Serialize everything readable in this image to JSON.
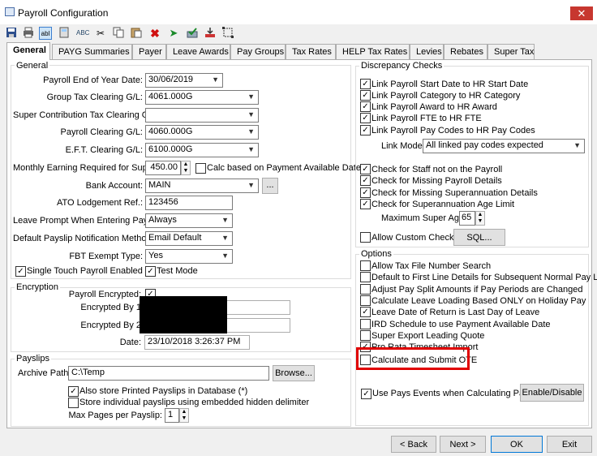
{
  "window": {
    "title": "Payroll Configuration",
    "close": "✕"
  },
  "toolbar": [
    "save-icon",
    "print-icon",
    "abl-icon",
    "calculator-icon",
    "spellcheck-icon",
    "cut-icon",
    "copy-icon",
    "paste-icon",
    "delete-icon",
    "arrow-icon",
    "approve-icon",
    "download-icon",
    "select-icon"
  ],
  "tabs": [
    "General",
    "PAYG Summaries",
    "Payer",
    "Leave Awards",
    "Pay Groups",
    "Tax Rates",
    "HELP Tax Rates",
    "Levies",
    "Rebates",
    "Super Tax"
  ],
  "general": {
    "title": "General",
    "eoy_label": "Payroll End of Year Date:",
    "eoy_value": "30/06/2019",
    "gtc_label": "Group Tax Clearing G/L:",
    "gtc_value": "4061.000G",
    "sct_label": "Super Contribution Tax Clearing G/L:",
    "sct_value": "",
    "pc_label": "Payroll Clearing G/L:",
    "pc_value": "4060.000G",
    "eft_label": "E.F.T. Clearing G/L:",
    "eft_value": "6100.000G",
    "mer_label": "Monthly Earning Required for Super:",
    "mer_value": "450.00",
    "calc_label": "Calc based on Payment Available Date",
    "bank_label": "Bank Account:",
    "bank_value": "MAIN",
    "bank_btn": "...",
    "ato_label": "ATO Lodgement Ref.:",
    "ato_value": "123456",
    "leave_label": "Leave Prompt When Entering Pays:",
    "leave_value": "Always",
    "notif_label": "Default Payslip Notification Method:",
    "notif_value": "Email Default",
    "fbt_label": "FBT Exempt Type:",
    "fbt_value": "Yes",
    "stp_label": "Single Touch Payroll Enabled",
    "test_label": "Test Mode"
  },
  "encryption": {
    "title": "Encryption",
    "pe_label": "Payroll Encrypted:",
    "by1_label": "Encrypted By 1",
    "by2_label": "Encrypted By 2",
    "date_label": "Date:",
    "date_value": "23/10/2018 3:26:37 PM"
  },
  "payslips": {
    "title": "Payslips",
    "archive_label": "Archive Path:",
    "archive_value": "C:\\Temp",
    "browse": "Browse...",
    "also_label": "Also store Printed Payslips in Database (*)",
    "store_label": "Store individual payslips using embedded hidden delimiter",
    "max_label": "Max Pages per Payslip:",
    "max_value": "1"
  },
  "discrepancy": {
    "title": "Discrepancy Checks",
    "items": [
      "Link Payroll Start Date to HR Start Date",
      "Link Payroll Category to HR Category",
      "Link Payroll Award to HR Award",
      "Link Payroll FTE to HR FTE",
      "Link Payroll Pay Codes to HR Pay Codes"
    ],
    "mode_label": "Link Mode:",
    "mode_value": "All linked pay codes expected",
    "checks": [
      "Check for Staff not on the Payroll",
      "Check for Missing Payroll Details",
      "Check for Missing Superannuation Details",
      "Check for Superannuation Age Limit"
    ],
    "max_age_label": "Maximum Super Age:",
    "max_age_value": "65",
    "custom_label": "Allow Custom Checks",
    "sql": "SQL..."
  },
  "options": {
    "title": "Options",
    "items": [
      {
        "label": "Allow Tax File Number Search",
        "checked": false
      },
      {
        "label": "Default to First Line Details for Subsequent Normal Pay Lines",
        "checked": false
      },
      {
        "label": "Adjust Pay Split Amounts if Pay Periods are Changed",
        "checked": false
      },
      {
        "label": "Calculate Leave Loading Based ONLY on Holiday Pay",
        "checked": false
      },
      {
        "label": "Leave Date of Return is Last Day of Leave",
        "checked": true
      },
      {
        "label": "IRD Schedule to use Payment Available Date",
        "checked": false
      },
      {
        "label": "Super Export Leading Quote",
        "checked": false
      },
      {
        "label": "Pro Rata Timesheet Import",
        "checked": true
      },
      {
        "label": "Calculate and Submit OTE",
        "checked": false
      }
    ],
    "events_label": "Use Pays Events when Calculating Pays",
    "enable_btn": "Enable/Disable"
  },
  "footer": {
    "back": "< Back",
    "next": "Next >",
    "ok": "OK",
    "exit": "Exit"
  },
  "colors": {
    "highlight": "#e00000",
    "close": "#c7372f"
  }
}
